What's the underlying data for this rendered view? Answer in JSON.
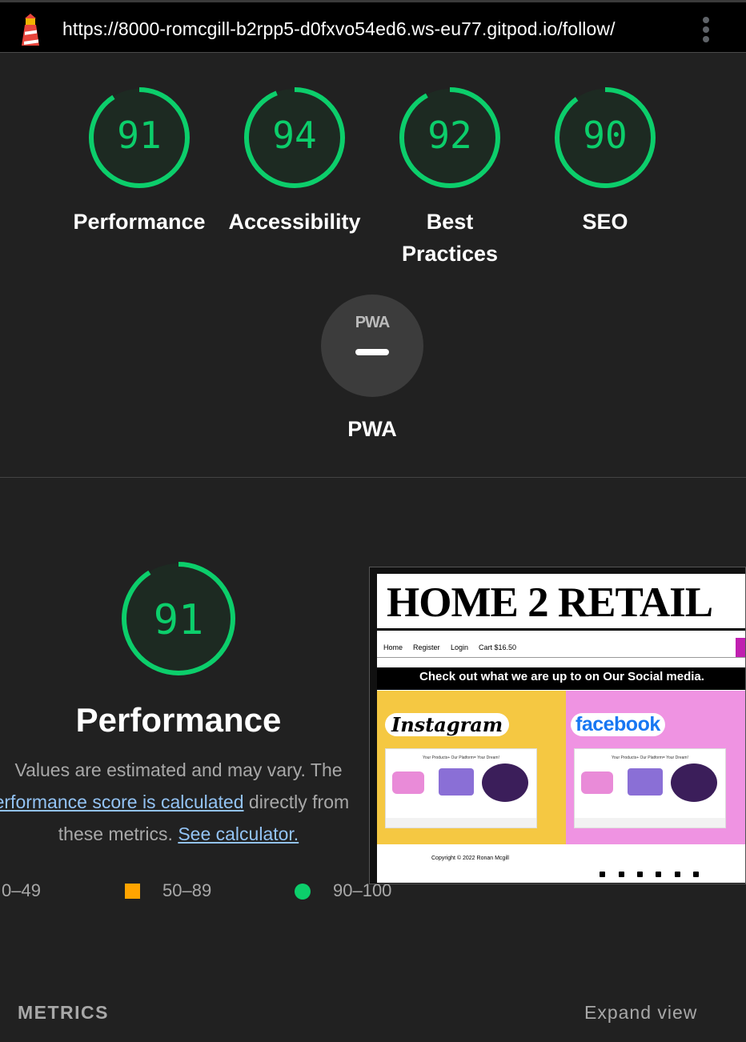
{
  "url_bar": {
    "url": "https://8000-romcgill-b2rpp5-d0fxvo54ed6.ws-eu77.gitpod.io/follow/"
  },
  "colors": {
    "pass": "#0cce6b",
    "average": "#ffa400",
    "link": "#93c3f4",
    "background": "#212121"
  },
  "categories": [
    {
      "id": "performance",
      "score": "91",
      "label": "Performance"
    },
    {
      "id": "accessibility",
      "score": "94",
      "label": "Accessibility"
    },
    {
      "id": "best-practices",
      "score": "92",
      "label_line1": "Best",
      "label_line2": "Practices"
    },
    {
      "id": "seo",
      "score": "90",
      "label": "SEO"
    }
  ],
  "pwa": {
    "badge": "PWA",
    "label": "PWA"
  },
  "performance_section": {
    "score": "91",
    "title": "Performance",
    "desc_line1": "Values are estimated and may vary. The",
    "link1": "performance score is calculated",
    "desc_after_link1": " directly from",
    "desc_line3": "these metrics. ",
    "link2": "See calculator."
  },
  "legend": {
    "fail": "0–49",
    "average": "50–89",
    "pass": "90–100"
  },
  "screenshot": {
    "title": "HOME 2 RETAIL",
    "nav": [
      "Home",
      "Register",
      "Login",
      "Cart $16.50"
    ],
    "banner": "Check out what we are up to on Our Social media.",
    "instagram": "Instagram",
    "facebook": "facebook",
    "mini_caption": "Your Products+ Our Platform= Your Dream!",
    "copyright": "Copyright © 2022 Ronan Mcgill"
  },
  "footer": {
    "metrics": "METRICS",
    "expand": "Expand view"
  }
}
